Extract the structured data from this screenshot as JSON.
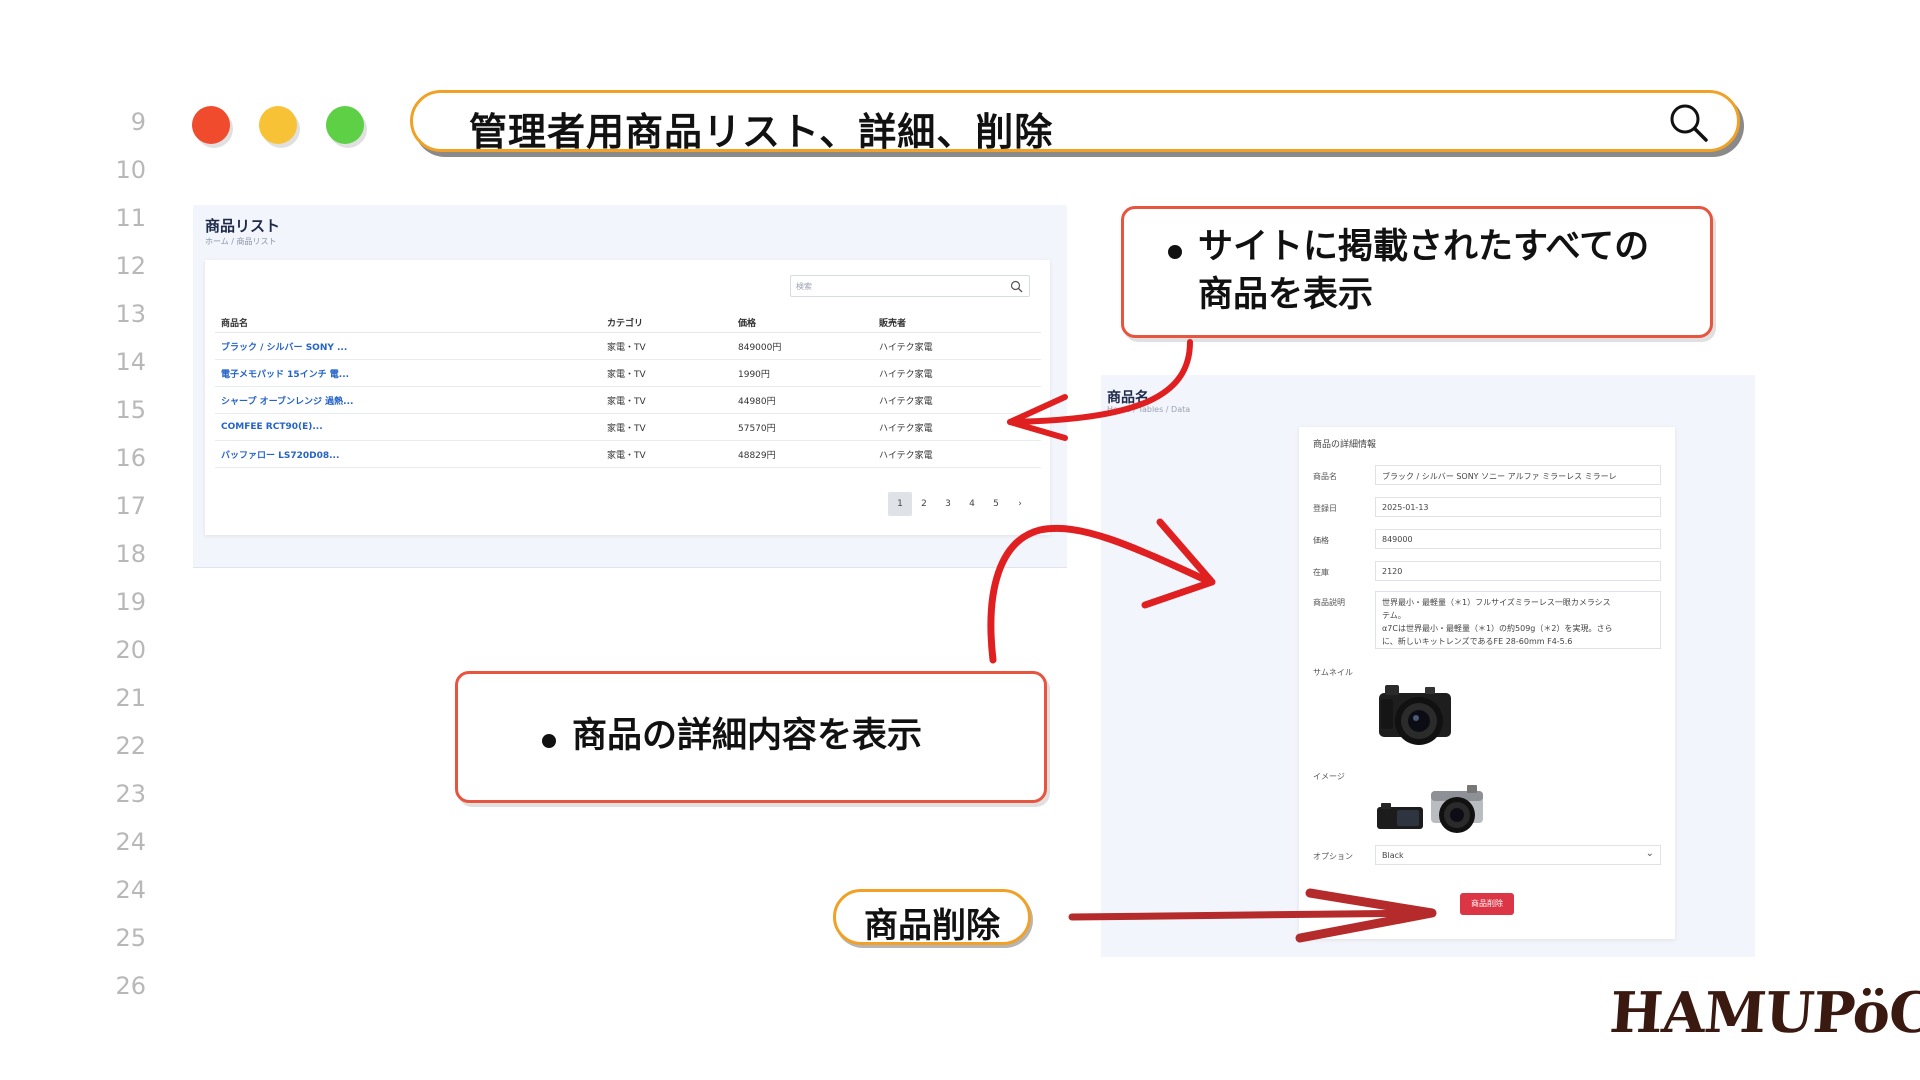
{
  "line_numbers": [
    "9",
    "10",
    "11",
    "12",
    "13",
    "14",
    "15",
    "16",
    "17",
    "18",
    "19",
    "20",
    "21",
    "22",
    "23",
    "24",
    "24",
    "25",
    "26"
  ],
  "header": {
    "title": "管理者用商品リスト、詳細、削除"
  },
  "product_list": {
    "title": "商品リスト",
    "breadcrumb": "ホーム / 商品リスト",
    "search_placeholder": "検索",
    "columns": [
      "商品名",
      "カテゴリ",
      "価格",
      "販売者"
    ],
    "rows": [
      [
        "ブラック / シルバー SONY ...",
        "家電・TV",
        "849000円",
        "ハイテク家電"
      ],
      [
        "電子メモパッド 15インチ 電...",
        "家電・TV",
        "1990円",
        "ハイテク家電"
      ],
      [
        "シャープ オーブンレンジ 過熱...",
        "家電・TV",
        "44980円",
        "ハイテク家電"
      ],
      [
        "COMFEE RCT90(E)...",
        "家電・TV",
        "57570円",
        "ハイテク家電"
      ],
      [
        "バッファロー LS720D08...",
        "家電・TV",
        "48829円",
        "ハイテク家電"
      ]
    ],
    "pages": [
      "1",
      "2",
      "3",
      "4",
      "5",
      "›"
    ]
  },
  "product_detail": {
    "title": "商品名",
    "breadcrumb": "Home / Tables / Data",
    "card_title": "商品の詳細情報",
    "labels": {
      "name": "商品名",
      "date": "登録日",
      "price": "価格",
      "stock": "在庫",
      "description": "商品説明",
      "thumbnail": "サムネイル",
      "images": "イメージ",
      "option": "オプション"
    },
    "values": {
      "name": "ブラック / シルバー SONY ソニー アルファ ミラーレス ミラーレ",
      "date": "2025-01-13",
      "price": "849000",
      "stock": "2120",
      "description_lines": [
        "世界最小・最軽量（＊1）フルサイズミラーレス一眼カメラシス",
        "テム。",
        "α7Cは世界最小・最軽量（＊1）の約509g（＊2）を実現。さら",
        "に、新しいキットレンズであるFE 28-60mm F4-5.6"
      ],
      "option": "Black"
    },
    "delete_button": "商品削除"
  },
  "callouts": {
    "all_products_line1": "サイトに掲載されたすべての",
    "all_products_line2": "商品を表示",
    "detail": "商品の詳細内容を表示",
    "delete": "商品削除"
  },
  "logo": "HAMUPöCHI",
  "colors": {
    "dot_red": "#f04b2c",
    "dot_yellow": "#f7c235",
    "dot_green": "#5dd045",
    "accent_orange": "#f0a126",
    "callout_border": "#e8553f",
    "arrow_red": "#e02020",
    "link_blue": "#2563c9",
    "delete_red": "#dc3545"
  }
}
